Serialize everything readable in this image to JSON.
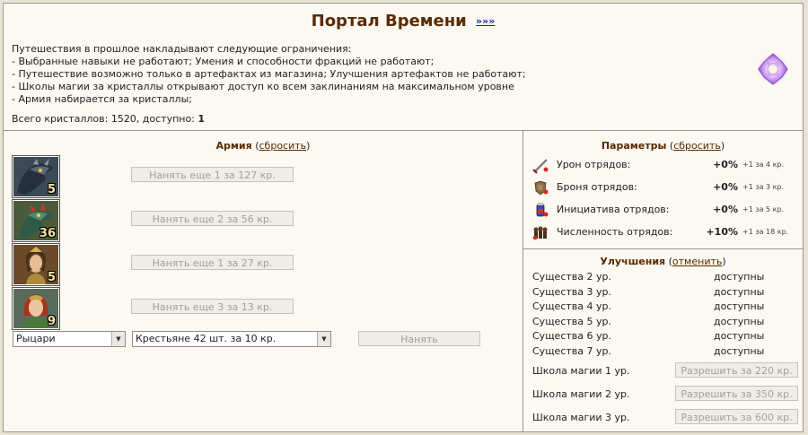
{
  "header": {
    "title": "Портал Времени",
    "title_link": "»»»",
    "restrictions": [
      "Путешествия в прошлое накладывают следующие ограничения:",
      "- Выбранные навыки не работают; Умения и способности фракций не работают;",
      "- Путешествие возможно только в артефактах из магазина; Улучшения артефактов не работают;",
      "- Школы магии за кристаллы открывают доступ ко всем заклинаниям на максимальном уровне",
      "- Армия набирается за кристаллы;"
    ],
    "crystals_label": "Всего кристаллов: 1520, доступно: ",
    "crystals_available": "1"
  },
  "army": {
    "title": "Армия",
    "reset_label": "сбросить",
    "units": [
      {
        "count": "5",
        "hire_label": "Нанять еще 1 за 127 кр."
      },
      {
        "count": "36",
        "hire_label": "Нанять еще 2 за 56 кр."
      },
      {
        "count": "5",
        "hire_label": "Нанять еще 1 за 27 кр."
      },
      {
        "count": "9",
        "hire_label": "Нанять еще 3 за 13 кр."
      }
    ],
    "faction_select": "Рыцари",
    "unit_select": "Крестьяне 42 шт. за 10 кр.",
    "hire_button": "Нанять"
  },
  "params": {
    "title": "Параметры",
    "reset_label": "сбросить",
    "rows": [
      {
        "name": "Урон отрядов:",
        "value": "+0%",
        "cost": "+1 за 4 кр.",
        "icon": "sword-icon"
      },
      {
        "name": "Броня отрядов:",
        "value": "+0%",
        "cost": "+1 за 3 кр.",
        "icon": "armor-icon"
      },
      {
        "name": "Инициатива отрядов:",
        "value": "+0%",
        "cost": "+1 за 5 кр.",
        "icon": "potion-icon"
      },
      {
        "name": "Численность отрядов:",
        "value": "+10%",
        "cost": "+1 за 18 кр.",
        "icon": "troops-icon"
      }
    ]
  },
  "upgrades": {
    "title": "Улучшения",
    "cancel_label": "отменить",
    "creatures": [
      {
        "name": "Существа 2 ур.",
        "status": "доступны"
      },
      {
        "name": "Существа 3 ур.",
        "status": "доступны"
      },
      {
        "name": "Существа 4 ур.",
        "status": "доступны"
      },
      {
        "name": "Существа 5 ур.",
        "status": "доступны"
      },
      {
        "name": "Существа 6 ур.",
        "status": "доступны"
      },
      {
        "name": "Существа 7 ур.",
        "status": "доступны"
      }
    ],
    "magic": [
      {
        "name": "Школа магии 1 ур.",
        "button": "Разрешить за 220 кр."
      },
      {
        "name": "Школа магии 2 ур.",
        "button": "Разрешить за 350 кр."
      },
      {
        "name": "Школа магии 3 ур.",
        "button": "Разрешить за 600 кр."
      }
    ]
  },
  "colors": {
    "heading": "#5a2a00",
    "link": "#1b2aa3",
    "background": "#fbf9f1",
    "border": "#9c9789"
  }
}
